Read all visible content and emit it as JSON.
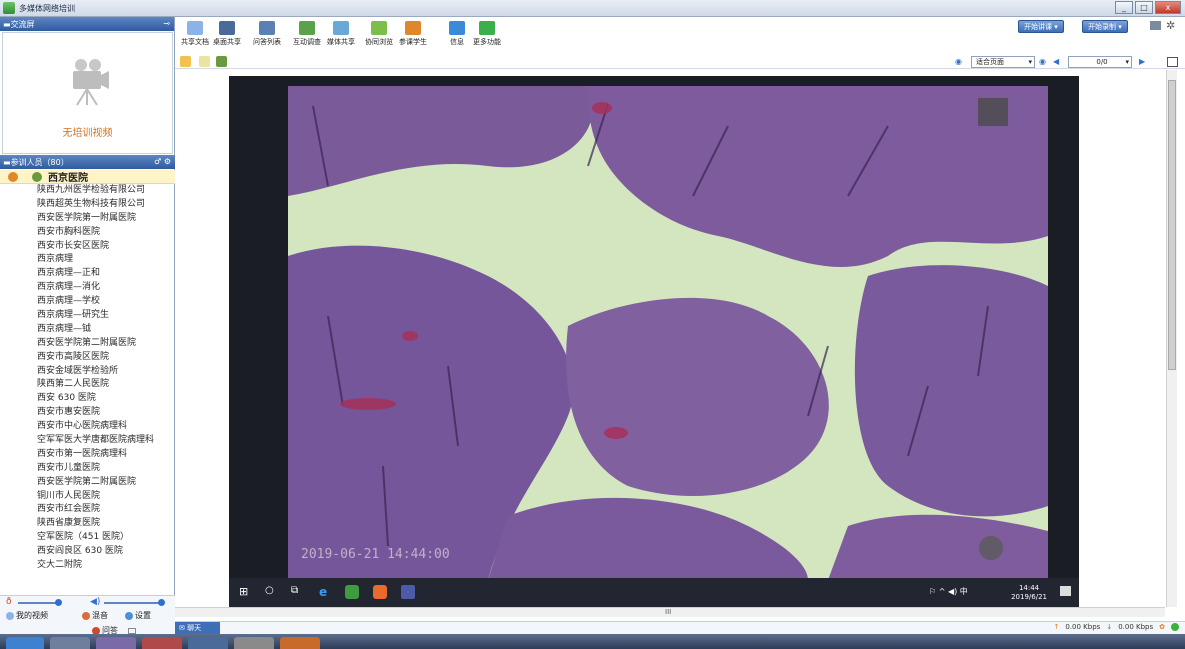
{
  "window": {
    "title": "多媒体网络培训"
  },
  "left_panel": {
    "video_header": "交流屏",
    "no_video": "无培训视频",
    "participants_header": "参训人员（80）",
    "root_org": "西京医院",
    "orgs": [
      "陕西九州医学检验有限公司",
      "陕西超英生物科技有限公司",
      "西安医学院第一附属医院",
      "西安市胸科医院",
      "西安市长安区医院",
      "西京病理",
      "西京病理—正和",
      "西京病理—消化",
      "西京病理—学校",
      "西京病理—研究生",
      "西京病理—钺",
      "西安医学院第二附属医院",
      "西安市高陵区医院",
      "西安金域医学检验所",
      "陕西第二人民医院",
      "西安 630 医院",
      "西安市惠安医院",
      "西安市中心医院病理科",
      "空军军医大学唐都医院病理科",
      "西安市第一医院病理科",
      "西安市儿童医院",
      "西安医学院第二附属医院",
      "铜川市人民医院",
      "西安市红会医院",
      "陕西省康复医院",
      "空军医院（451 医院）",
      "西安阎良区 630 医院",
      "交大二附院"
    ],
    "bottom": {
      "my_video": "我的视频",
      "mix": "混音",
      "settings": "设置",
      "qa": "问答"
    }
  },
  "toolbar": {
    "tools": [
      "共享文档",
      "桌面共享",
      "问答列表",
      "互动调查",
      "媒体共享",
      "协同浏览",
      "参课学生",
      "信息",
      "更多功能"
    ],
    "start_class": "开始讲课",
    "start_record": "开始录制"
  },
  "docbar": {
    "zoom": "适合页面",
    "page": "0/0"
  },
  "slide": {
    "timestamp": "2019-06-21  14:44:00",
    "clock_time": "14:44",
    "clock_date": "2019/6/21",
    "tray_text": "中"
  },
  "hscroll": {
    "mid": "III"
  },
  "chat": {
    "tab": "聊天"
  },
  "stats": {
    "up": "0.00 Kbps",
    "down": "0.00 Kbps"
  },
  "colors": {
    "accent": "#3d6fb6",
    "orange": "#d4701e",
    "tissue": "#7b5a9a",
    "stroma": "#cfe3b8"
  }
}
